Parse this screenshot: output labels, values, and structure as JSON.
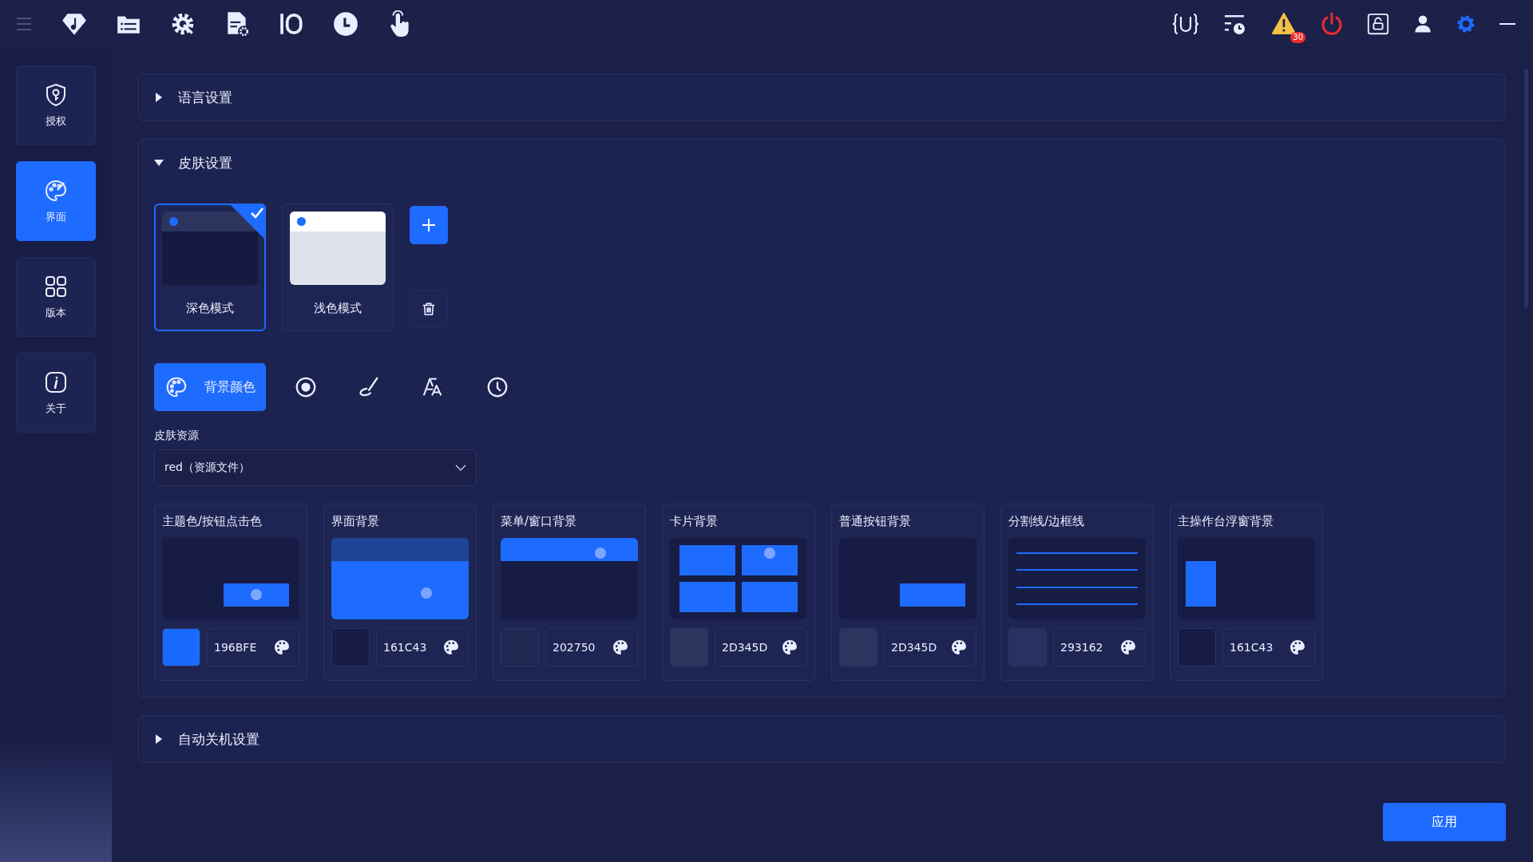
{
  "topbar": {
    "alert_count": "30"
  },
  "sidebar": {
    "items": [
      {
        "kind": "auth",
        "label": "授权",
        "selected": false
      },
      {
        "kind": "palette",
        "label": "界面",
        "selected": true
      },
      {
        "kind": "grid",
        "label": "版本",
        "selected": false
      },
      {
        "kind": "info",
        "label": "关于",
        "selected": false
      }
    ]
  },
  "sections": [
    {
      "title": "语言设置",
      "expanded": false
    },
    {
      "title": "皮肤设置",
      "expanded": true
    },
    {
      "title": "自动关机设置",
      "expanded": false
    }
  ],
  "skin": {
    "themes": [
      {
        "kind": "dark",
        "label": "深色模式",
        "selected": true
      },
      {
        "kind": "light",
        "label": "浅色模式",
        "selected": false
      }
    ],
    "tools": [
      {
        "kind": "palette",
        "label": "背景颜色",
        "selected": true
      },
      {
        "kind": "radio",
        "selected": false
      },
      {
        "kind": "brush",
        "selected": false
      },
      {
        "kind": "font",
        "selected": false
      },
      {
        "kind": "clock",
        "selected": false
      }
    ],
    "resource": {
      "label": "皮肤资源",
      "value": "red（资源文件）"
    },
    "colors": [
      {
        "kind": "button",
        "title": "主题色/按钮点击色",
        "color": "#196bfe",
        "hex": "196BFE"
      },
      {
        "kind": "page",
        "title": "界面背景",
        "color": "#161c43",
        "hex": "161C43"
      },
      {
        "kind": "menu",
        "title": "菜单/窗口背景",
        "color": "#202750",
        "hex": "202750"
      },
      {
        "kind": "cards",
        "title": "卡片背景",
        "color": "#2d345d",
        "hex": "2D345D"
      },
      {
        "kind": "plain",
        "title": "普通按钮背景",
        "color": "#2d345d",
        "hex": "2D345D"
      },
      {
        "kind": "lines",
        "title": "分割线/边框线",
        "color": "#293162",
        "hex": "293162"
      },
      {
        "kind": "float",
        "title": "主操作台浮窗背景",
        "color": "#161c43",
        "hex": "161C43"
      }
    ]
  },
  "apply_button": "应用"
}
